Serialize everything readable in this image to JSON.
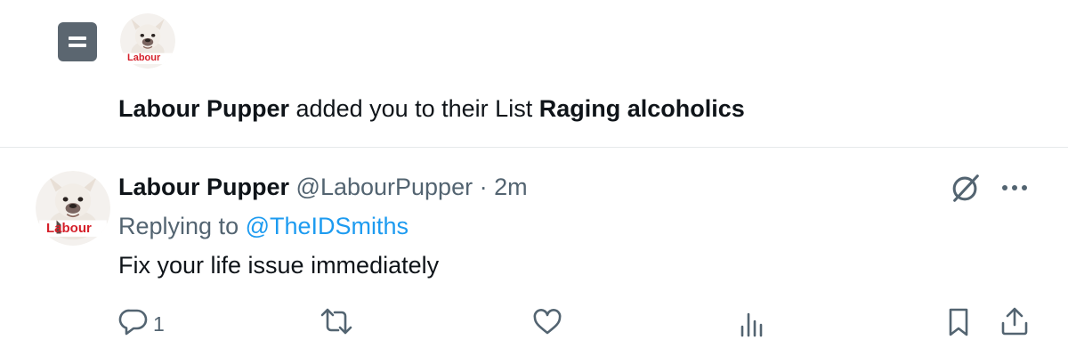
{
  "notification": {
    "icon": "list-icon",
    "actor_name": "Labour Pupper",
    "action_text": " added you to their List ",
    "list_name": "Raging alcoholics",
    "avatar": {
      "icon": "bulldog-avatar",
      "badge_text": "Labour"
    }
  },
  "tweet": {
    "author_name": "Labour Pupper",
    "handle": "@LabourPupper",
    "separator": " · ",
    "time": "2m",
    "replying_prefix": "Replying to ",
    "replying_to": "@TheIDSmiths",
    "text": "Fix your life issue immediately",
    "avatar": {
      "icon": "bulldog-avatar",
      "badge_text": "Labour"
    },
    "header_icons": [
      "grok-icon",
      "more-icon"
    ],
    "actions": {
      "reply_count": "1",
      "icons": [
        "reply-icon",
        "retweet-icon",
        "like-icon",
        "views-icon",
        "bookmark-icon",
        "share-icon"
      ]
    }
  },
  "colors": {
    "text": "#0f1419",
    "muted": "#536471",
    "link": "#1d9bf0",
    "list_icon_bg": "#5b6670",
    "divider": "#e6e9eb",
    "badge_red": "#d5202a"
  }
}
